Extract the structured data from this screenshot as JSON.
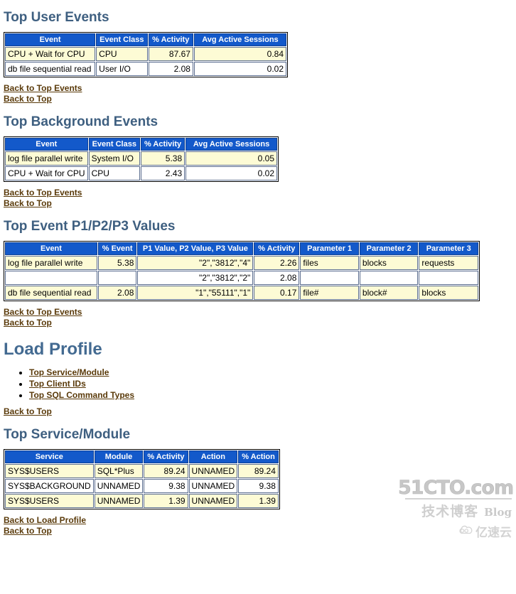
{
  "sections": {
    "top_user_events": {
      "heading": "Top User Events",
      "table": {
        "columns": [
          "Event",
          "Event Class",
          "% Activity",
          "Avg Active Sessions"
        ],
        "rows": [
          [
            "CPU + Wait for CPU",
            "CPU",
            "87.67",
            "0.84"
          ],
          [
            "db file sequential read",
            "User I/O",
            "2.08",
            "0.02"
          ]
        ]
      },
      "links": [
        "Back to Top Events",
        "Back to Top"
      ]
    },
    "top_background_events": {
      "heading": "Top Background Events",
      "table": {
        "columns": [
          "Event",
          "Event Class",
          "% Activity",
          "Avg Active Sessions"
        ],
        "rows": [
          [
            "log file parallel write",
            "System I/O",
            "5.38",
            "0.05"
          ],
          [
            "CPU + Wait for CPU",
            "CPU",
            "2.43",
            "0.02"
          ]
        ]
      },
      "links": [
        "Back to Top Events",
        "Back to Top"
      ]
    },
    "top_event_p1p2p3": {
      "heading": "Top Event P1/P2/P3 Values",
      "table": {
        "columns": [
          "Event",
          "% Event",
          "P1 Value, P2 Value, P3 Value",
          "% Activity",
          "Parameter 1",
          "Parameter 2",
          "Parameter 3"
        ],
        "rows": [
          [
            "log file parallel write",
            "5.38",
            "\"2\",\"3812\",\"4\"",
            "2.26",
            "files",
            "blocks",
            "requests"
          ],
          [
            "",
            "",
            "\"2\",\"3812\",\"2\"",
            "2.08",
            "",
            "",
            ""
          ],
          [
            "db file sequential read",
            "2.08",
            "\"1\",\"55111\",\"1\"",
            "0.17",
            "file#",
            "block#",
            "blocks"
          ]
        ]
      },
      "links": [
        "Back to Top Events",
        "Back to Top"
      ]
    },
    "load_profile": {
      "heading": "Load Profile",
      "list_links": [
        "Top Service/Module",
        "Top Client IDs",
        "Top SQL Command Types"
      ],
      "links": [
        "Back to Top"
      ]
    },
    "top_service_module": {
      "heading": "Top Service/Module",
      "table": {
        "columns": [
          "Service",
          "Module",
          "% Activity",
          "Action",
          "% Action"
        ],
        "rows": [
          [
            "SYS$USERS",
            "SQL*Plus",
            "89.24",
            "UNNAMED",
            "89.24"
          ],
          [
            "SYS$BACKGROUND",
            "UNNAMED",
            "9.38",
            "UNNAMED",
            "9.38"
          ],
          [
            "SYS$USERS",
            "UNNAMED",
            "1.39",
            "UNNAMED",
            "1.39"
          ]
        ]
      },
      "links": [
        "Back to Load Profile",
        "Back to Top"
      ]
    }
  },
  "watermark": {
    "main": "51CTO.com",
    "cn": "技术博客",
    "blog": "Blog",
    "cloud_icon": "cloud-icon",
    "ys": "亿速云"
  },
  "colors": {
    "heading": "#3e5f80",
    "heading_large": "#436a91",
    "table_header_bg": "#1359ca",
    "row_odd_bg": "#fdfbd5",
    "row_even_bg": "#ffffff",
    "link": "#5a3a0a"
  }
}
